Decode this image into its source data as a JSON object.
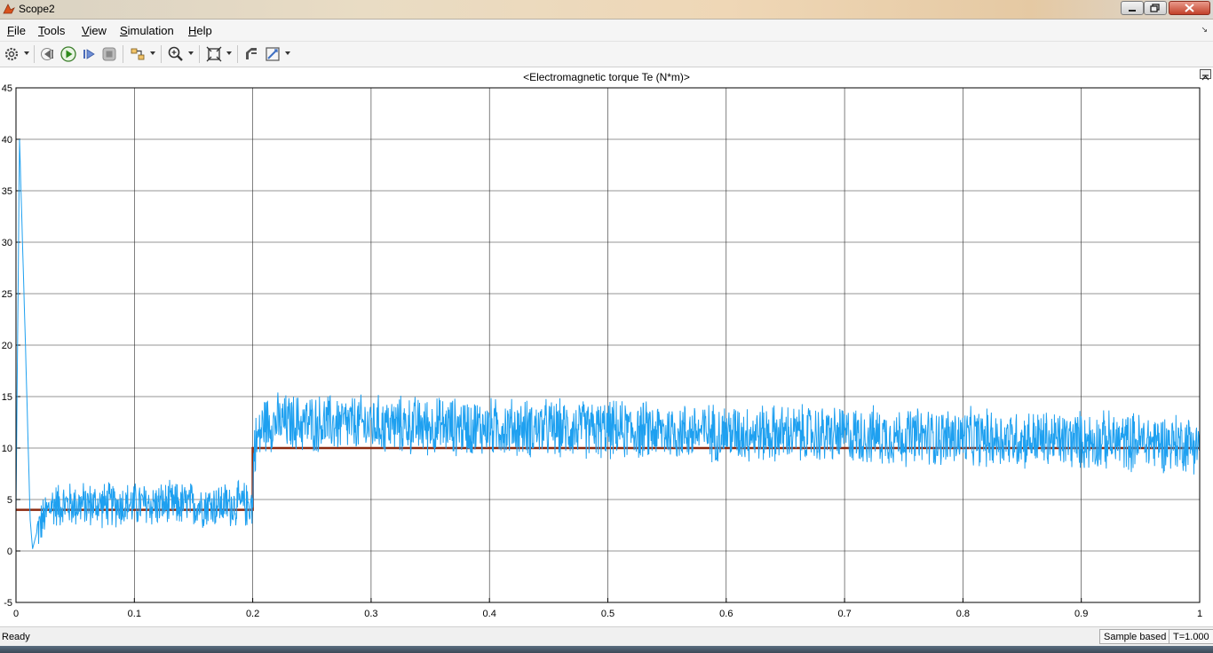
{
  "window": {
    "title": "Scope2"
  },
  "menu": {
    "items": [
      {
        "key": "F",
        "rest": "ile"
      },
      {
        "key": "T",
        "rest": "ools"
      },
      {
        "key": "V",
        "rest": "iew"
      },
      {
        "key": "S",
        "rest": "imulation"
      },
      {
        "key": "H",
        "rest": "elp"
      }
    ]
  },
  "toolbar": {
    "icons": [
      "settings-icon",
      "step-back-icon",
      "run-icon",
      "step-forward-icon",
      "stop-icon",
      "signal-selector-icon",
      "zoom-icon",
      "autoscale-icon",
      "highlight-block-icon",
      "style-icon"
    ]
  },
  "chart_data": {
    "type": "line",
    "title": "<Electromagnetic torque Te (N*m)>",
    "xlabel": "",
    "ylabel": "",
    "xlim": [
      0,
      1
    ],
    "ylim": [
      -5,
      45
    ],
    "xticks": [
      "0",
      "0.1",
      "0.2",
      "0.3",
      "0.4",
      "0.5",
      "0.6",
      "0.7",
      "0.8",
      "0.9",
      "1"
    ],
    "yticks": [
      "45",
      "40",
      "35",
      "30",
      "25",
      "20",
      "15",
      "10",
      "5",
      "0",
      "-5"
    ],
    "grid": true,
    "background": "#ffffff",
    "series": [
      {
        "color": "#1ea0f0",
        "description_points": [
          [
            0,
            4
          ],
          [
            0.003,
            40
          ],
          [
            0.008,
            20
          ],
          [
            0.012,
            3
          ],
          [
            0.014,
            0.2
          ],
          [
            0.018,
            2
          ],
          [
            0.03,
            4.5
          ],
          [
            0.2,
            4.5
          ],
          [
            0.201,
            10
          ],
          [
            0.21,
            12.5
          ],
          [
            1.0,
            10.5
          ]
        ],
        "noise": [
          {
            "from": 0.018,
            "to": 0.2,
            "amplitude": 2.5
          },
          {
            "from": 0.2,
            "to": 1.0,
            "amplitude": 3.2
          }
        ]
      },
      {
        "color": "#8b2a10",
        "points": [
          [
            0,
            4
          ],
          [
            0.2,
            4
          ],
          [
            0.2,
            10
          ],
          [
            1.0,
            10
          ]
        ]
      }
    ]
  },
  "status": {
    "text": "Ready",
    "sample_mode": "Sample based",
    "time": "T=1.000"
  }
}
